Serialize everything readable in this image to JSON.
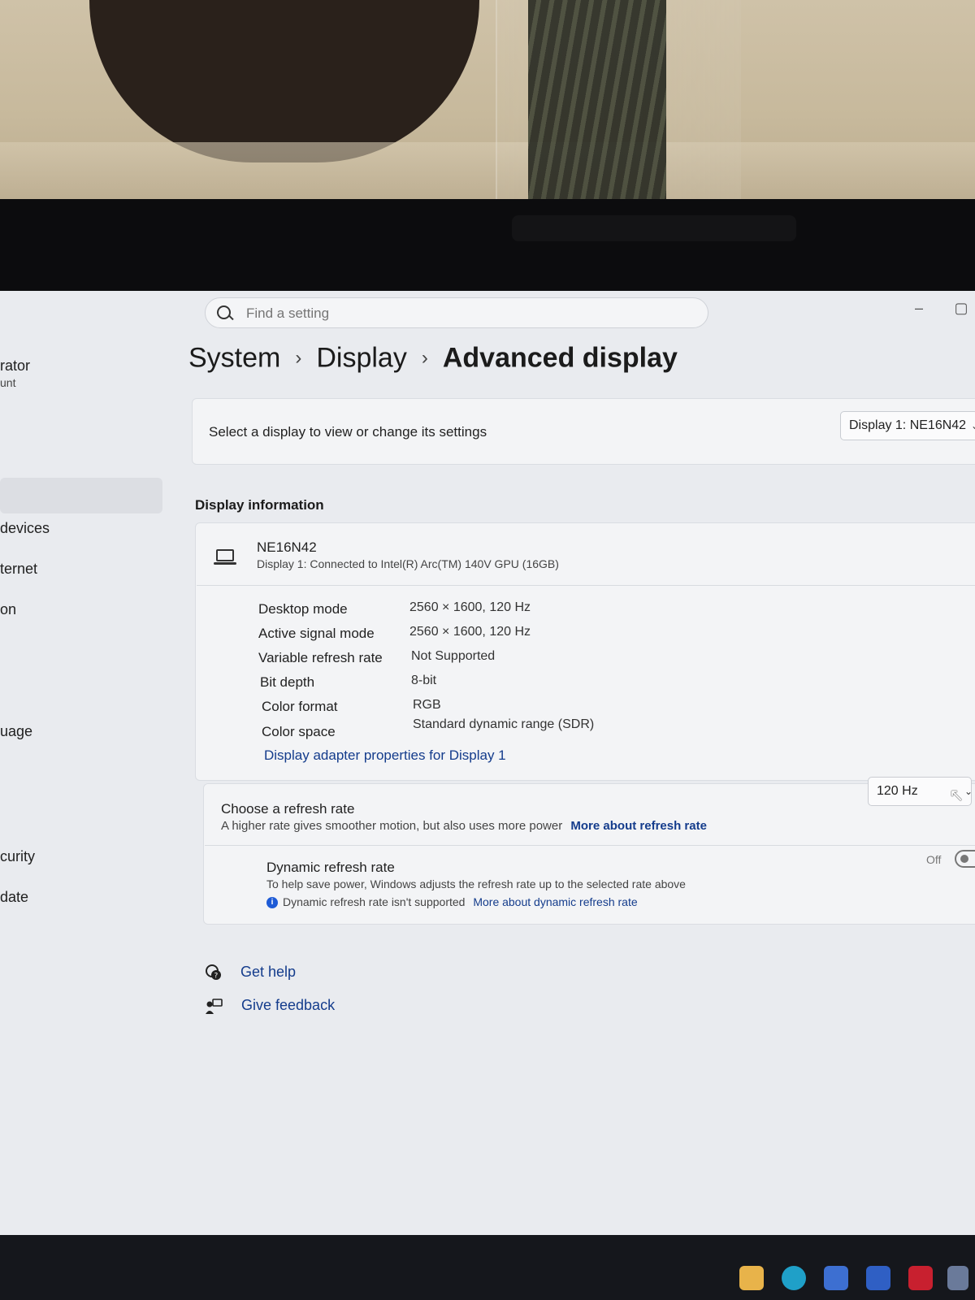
{
  "window": {
    "search_placeholder": "Find a setting",
    "minimize_glyph": "–",
    "maximize_glyph": "▢"
  },
  "sidebar": {
    "items": [
      {
        "label": "rator"
      },
      {
        "label": "unt"
      },
      {
        "label": "devices"
      },
      {
        "label": "ternet"
      },
      {
        "label": "on"
      },
      {
        "label": "uage"
      },
      {
        "label": "curity"
      },
      {
        "label": "date"
      }
    ]
  },
  "breadcrumb": {
    "items": [
      "System",
      "Display",
      "Advanced display"
    ],
    "separator": "›"
  },
  "display_select": {
    "prompt": "Select a display to view or change its settings",
    "selected": "Display 1: NE16N42"
  },
  "display_information": {
    "section_title": "Display information",
    "monitor_name": "NE16N42",
    "connection": "Display 1: Connected to Intel(R) Arc(TM) 140V GPU (16GB)",
    "rows": [
      {
        "label": "Desktop mode",
        "value": "2560 × 1600, 120 Hz"
      },
      {
        "label": "Active signal mode",
        "value": "2560 × 1600, 120 Hz"
      },
      {
        "label": "Variable refresh rate",
        "value": "Not Supported"
      },
      {
        "label": "Bit depth",
        "value": "8-bit"
      },
      {
        "label": "Color format",
        "value": "RGB"
      },
      {
        "label": "Color space",
        "value": "Standard dynamic range (SDR)"
      }
    ],
    "adapter_link": "Display adapter properties for Display 1"
  },
  "refresh_rate": {
    "title": "Choose a refresh rate",
    "description": "A higher rate gives smoother motion, but also uses more power",
    "more_link": "More about refresh rate",
    "selected": "120 Hz"
  },
  "dynamic_refresh": {
    "title": "Dynamic refresh rate",
    "description": "To help save power, Windows adjusts the refresh rate up to the selected rate above",
    "notice": "Dynamic refresh rate isn't supported",
    "more_link": "More about dynamic refresh rate",
    "state": "Off"
  },
  "footer": {
    "get_help": "Get help",
    "give_feedback": "Give feedback"
  },
  "colors": {
    "accent_link": "#143c8c",
    "info_blue": "#1e5bd6",
    "window_bg": "#e9ebef"
  },
  "taskbar_icons": [
    "explorer-icon",
    "edge-icon",
    "store-icon",
    "security-icon",
    "mcafee-icon",
    "app-icon"
  ]
}
